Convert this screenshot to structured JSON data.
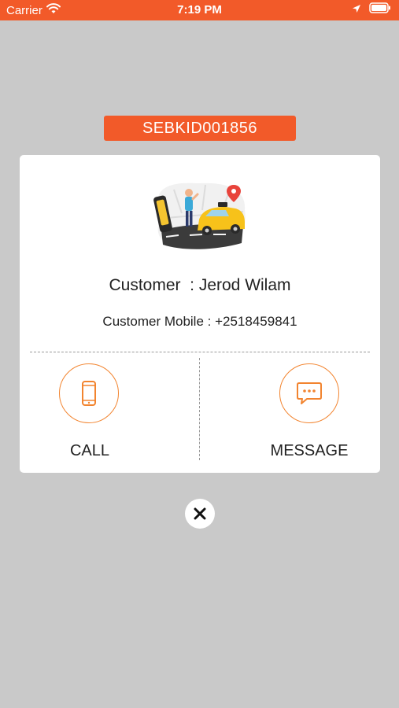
{
  "status_bar": {
    "carrier": "Carrier",
    "time": "7:19 PM",
    "background_color": "#f25a29",
    "icons": [
      "wifi-icon",
      "location-arrow-icon",
      "battery-icon"
    ]
  },
  "booking": {
    "id": "SEBKID001856"
  },
  "card": {
    "illustration": "taxi-illustration",
    "customer_name": "Customer  : Jerod Wilam",
    "customer_mobile": "Customer Mobile : +2518459841"
  },
  "actions": {
    "call": {
      "label": "CALL",
      "icon": "phone-icon"
    },
    "message": {
      "label": "MESSAGE",
      "icon": "message-icon"
    },
    "accent_color": "#f2842f"
  },
  "close": {
    "icon": "close-icon"
  }
}
